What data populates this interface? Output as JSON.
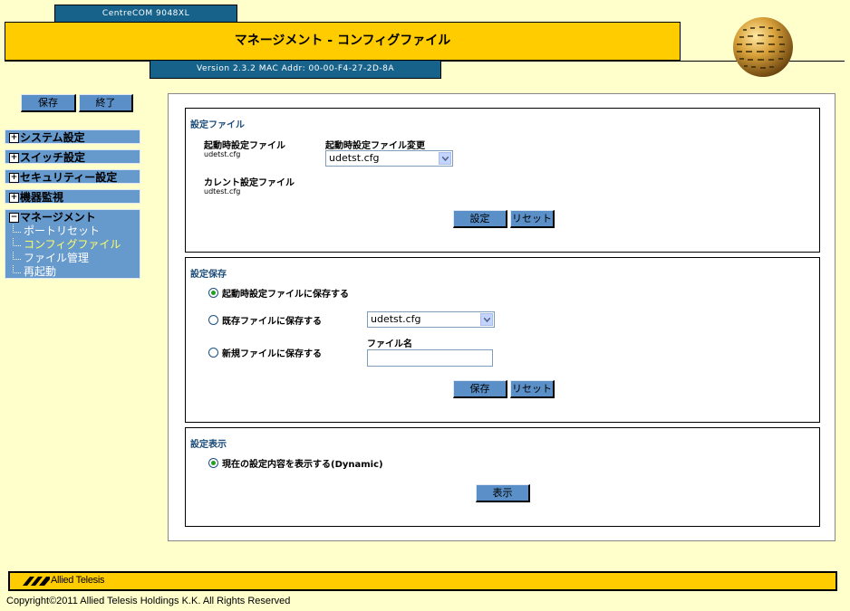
{
  "header": {
    "product": "CentreCOM 9048XL",
    "title": "マネージメント - コンフィグファイル",
    "version": "Version 2.3.2 MAC Addr: 00-00-F4-27-2D-8A"
  },
  "toolbar": {
    "save_label": "保存",
    "exit_label": "終了"
  },
  "sidebar": {
    "items": [
      {
        "label": "システム設定"
      },
      {
        "label": "スイッチ設定"
      },
      {
        "label": "セキュリティー設定"
      },
      {
        "label": "機器監視"
      },
      {
        "label": "マネージメント"
      }
    ],
    "subitems": [
      {
        "label": "ポートリセット"
      },
      {
        "label": "コンフィグファイル"
      },
      {
        "label": "ファイル管理"
      },
      {
        "label": "再起動"
      }
    ]
  },
  "config_file": {
    "section_title": "設定ファイル",
    "startup_label": "起動時設定ファイル",
    "startup_value": "udetst.cfg",
    "change_label": "起動時設定ファイル変更",
    "change_selected": "udetst.cfg",
    "current_label": "カレント設定ファイル",
    "current_value": "udtest.cfg",
    "set_button": "設定",
    "reset_button": "リセット"
  },
  "config_save": {
    "section_title": "設定保存",
    "option1": "起動時設定ファイルに保存する",
    "option2": "既存ファイルに保存する",
    "option2_selected": "udetst.cfg",
    "option3": "新規ファイルに保存する",
    "filename_label": "ファイル名",
    "filename_value": "",
    "save_button": "保存",
    "reset_button": "リセット"
  },
  "config_show": {
    "section_title": "設定表示",
    "option1": "現在の設定内容を表示する(Dynamic)",
    "show_button": "表示"
  },
  "footer": {
    "logo_text": "Allied Telesis",
    "copyright": "Copyright©2011 Allied Telesis Holdings K.K. All Rights Reserved"
  },
  "colors": {
    "background": "#ffffcc",
    "title_bar": "#ffcc00",
    "header_tab": "#16628a",
    "nav": "#6699cc",
    "button": "#5b8fc8",
    "section_title": "#1c4d7a",
    "active_nav": "#ffff66"
  }
}
